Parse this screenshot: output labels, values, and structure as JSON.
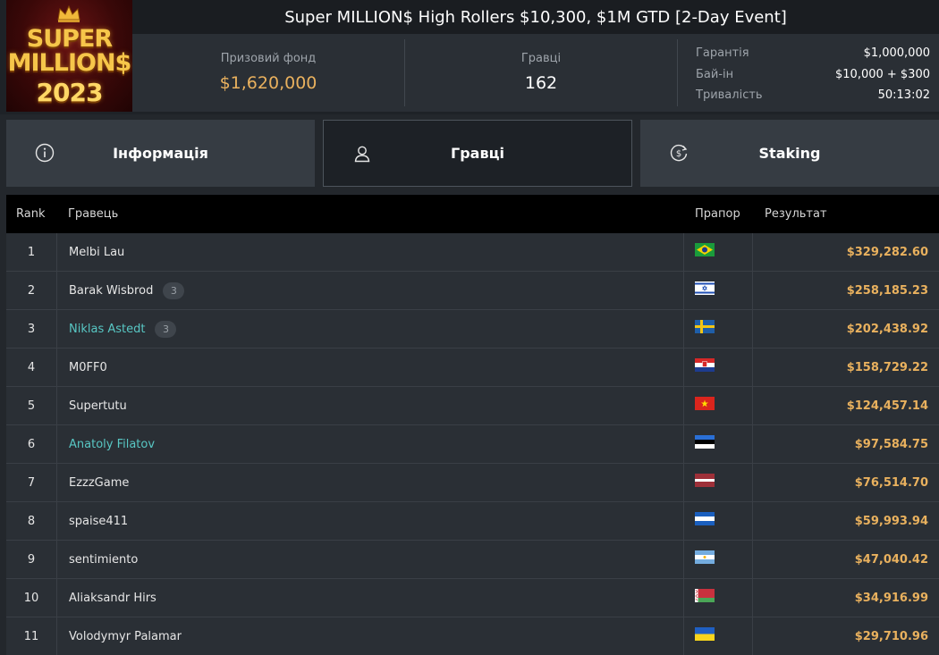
{
  "logo": {
    "line1": "SUPER",
    "line2": "MILLION$",
    "line3": "2023"
  },
  "title": "Super MILLION$ High Rollers $10,300, $1M GTD [2-Day Event]",
  "stats": {
    "prize_label": "Призовий фонд",
    "prize_value": "$1,620,000",
    "players_label": "Гравці",
    "players_value": "162"
  },
  "details": [
    {
      "key": "Гарантія",
      "value": "$1,000,000"
    },
    {
      "key": "Бай-ін",
      "value": "$10,000 + $300"
    },
    {
      "key": "Тривалість",
      "value": "50:13:02"
    }
  ],
  "tabs": [
    {
      "label": "Інформація",
      "icon": "info-icon",
      "active": false
    },
    {
      "label": "Гравці",
      "icon": "user-icon",
      "active": true
    },
    {
      "label": "Staking",
      "icon": "staking-icon",
      "active": false
    }
  ],
  "table": {
    "headers": {
      "rank": "Rank",
      "player": "Гравець",
      "flag": "Прапор",
      "result": "Результат"
    },
    "rows": [
      {
        "rank": "1",
        "name": "Melbi Lau",
        "badge": "",
        "highlight": false,
        "flag": "brazil",
        "result": "$329,282.60"
      },
      {
        "rank": "2",
        "name": "Barak Wisbrod",
        "badge": "3",
        "highlight": false,
        "flag": "israel",
        "result": "$258,185.23"
      },
      {
        "rank": "3",
        "name": "Niklas Astedt",
        "badge": "3",
        "highlight": true,
        "flag": "sweden",
        "result": "$202,438.92"
      },
      {
        "rank": "4",
        "name": "M0FF0",
        "badge": "",
        "highlight": false,
        "flag": "croatia",
        "result": "$158,729.22"
      },
      {
        "rank": "5",
        "name": "Supertutu",
        "badge": "",
        "highlight": false,
        "flag": "vietnam",
        "result": "$124,457.14"
      },
      {
        "rank": "6",
        "name": "Anatoly Filatov",
        "badge": "",
        "highlight": true,
        "flag": "estonia",
        "result": "$97,584.75"
      },
      {
        "rank": "7",
        "name": "EzzzGame",
        "badge": "",
        "highlight": false,
        "flag": "latvia",
        "result": "$76,514.70"
      },
      {
        "rank": "8",
        "name": "spaise411",
        "badge": "",
        "highlight": false,
        "flag": "nicaragua",
        "result": "$59,993.94"
      },
      {
        "rank": "9",
        "name": "sentimiento",
        "badge": "",
        "highlight": false,
        "flag": "argentina",
        "result": "$47,040.42"
      },
      {
        "rank": "10",
        "name": "Aliaksandr Hirs",
        "badge": "",
        "highlight": false,
        "flag": "belarus",
        "result": "$34,916.99"
      },
      {
        "rank": "11",
        "name": "Volodymyr Palamar",
        "badge": "",
        "highlight": false,
        "flag": "ukraine",
        "result": "$29,710.96"
      }
    ]
  },
  "colors": {
    "accent": "#e9b15e",
    "highlight": "#58c7c4"
  }
}
